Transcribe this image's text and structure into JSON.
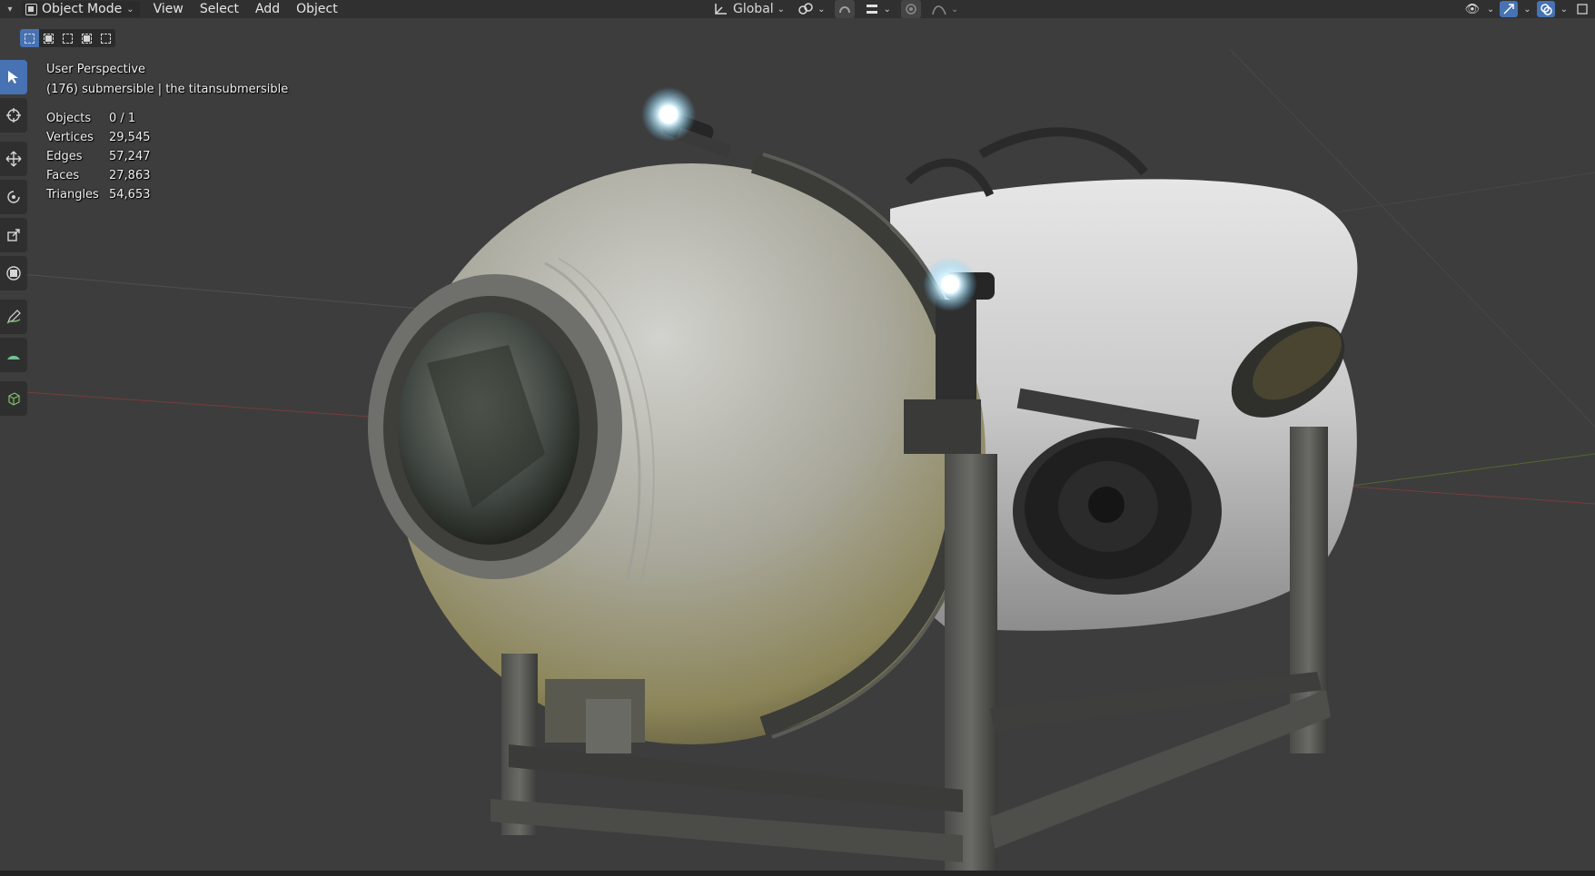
{
  "header": {
    "mode_label": "Object Mode",
    "menu": [
      "View",
      "Select",
      "Add",
      "Object"
    ],
    "transform_orientation": "Global",
    "icons": [
      "editor-type-icon",
      "object-mode-icon",
      "transform-orientation-icon",
      "pivot-point-icon",
      "snap-icon",
      "snap-increment-icon",
      "proportional-editing-icon",
      "falloff-icon",
      "visibility-icon",
      "gizmo-icon",
      "overlay-icon",
      "xray-icon"
    ]
  },
  "tool_settings": {
    "select_modes": [
      "select-new",
      "select-extend",
      "select-subtract",
      "select-invert",
      "select-intersect"
    ]
  },
  "toolbar": {
    "tools": [
      "select-box-tool",
      "cursor-tool",
      "move-tool",
      "rotate-tool",
      "scale-tool",
      "transform-tool",
      "annotate-tool",
      "measure-tool",
      "add-cube-tool"
    ]
  },
  "viewport": {
    "perspective_label": "User Perspective",
    "object_label": "(176) submersible | the titansubmersible",
    "stats": [
      {
        "label": "Objects",
        "value": "0 / 1"
      },
      {
        "label": "Vertices",
        "value": "29,545"
      },
      {
        "label": "Edges",
        "value": "57,247"
      },
      {
        "label": "Faces",
        "value": "27,863"
      },
      {
        "label": "Triangles",
        "value": "54,653"
      }
    ]
  },
  "colors": {
    "header_bg": "#303030",
    "viewport_bg": "#3d3d3d",
    "accent": "#4772b3",
    "x_axis": "#9b3e3e",
    "y_axis": "#5b7a2e"
  }
}
